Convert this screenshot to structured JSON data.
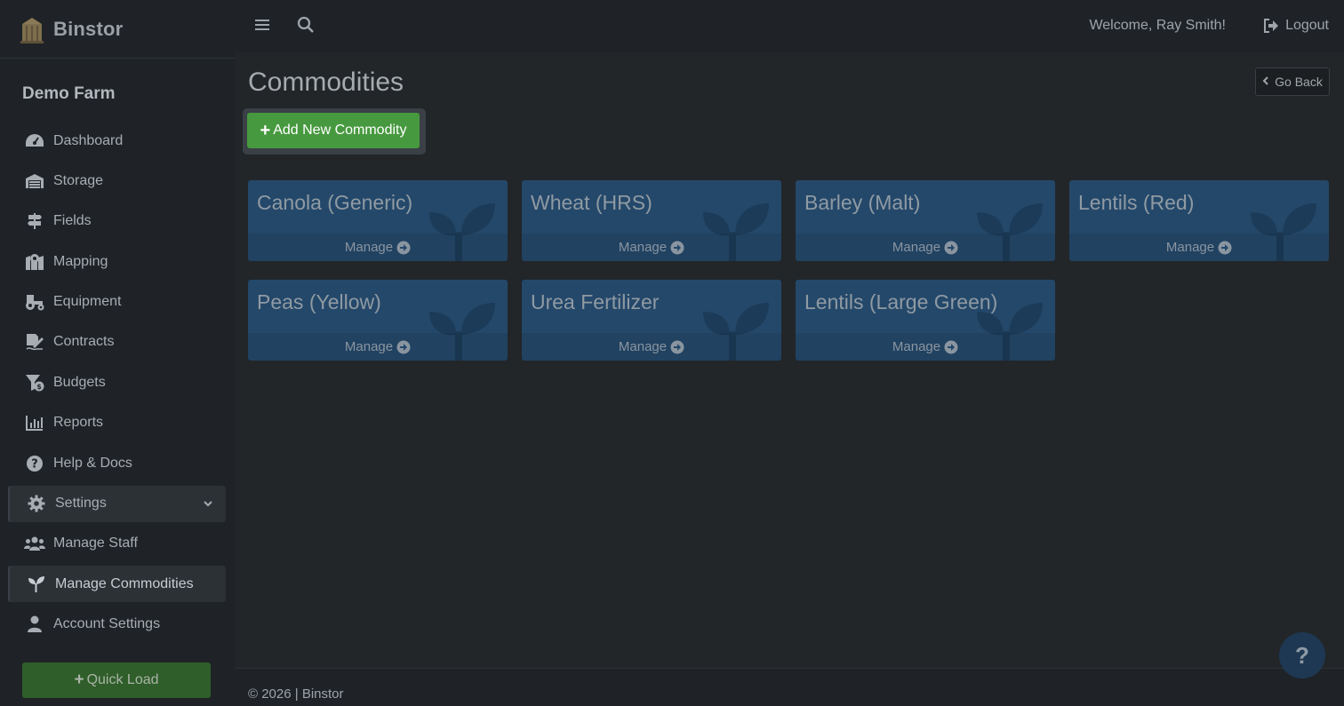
{
  "brand": {
    "name": "Binstor"
  },
  "sidebar": {
    "farm_name": "Demo Farm",
    "items": [
      {
        "label": "Dashboard",
        "icon": "gauge-icon"
      },
      {
        "label": "Storage",
        "icon": "warehouse-icon"
      },
      {
        "label": "Fields",
        "icon": "signs-icon"
      },
      {
        "label": "Mapping",
        "icon": "map-marker-icon"
      },
      {
        "label": "Equipment",
        "icon": "tractor-icon"
      },
      {
        "label": "Contracts",
        "icon": "signature-icon"
      },
      {
        "label": "Budgets",
        "icon": "funnel-dollar-icon"
      },
      {
        "label": "Reports",
        "icon": "bar-chart-icon"
      },
      {
        "label": "Help & Docs",
        "icon": "question-circle-icon"
      },
      {
        "label": "Settings",
        "icon": "gear-icon",
        "state": "open"
      },
      {
        "label": "Manage Staff",
        "icon": "users-icon"
      },
      {
        "label": "Manage Commodities",
        "icon": "seedling-icon",
        "state": "active"
      },
      {
        "label": "Account Settings",
        "icon": "user-icon"
      }
    ],
    "quick_load": "Quick Load"
  },
  "topbar": {
    "welcome": "Welcome, Ray Smith!",
    "logout": "Logout"
  },
  "main": {
    "title": "Commodities",
    "go_back": "Go Back",
    "add_button": "Add New Commodity",
    "commodities": [
      {
        "name": "Canola (Generic)",
        "action": "Manage"
      },
      {
        "name": "Wheat (HRS)",
        "action": "Manage"
      },
      {
        "name": "Barley (Malt)",
        "action": "Manage"
      },
      {
        "name": "Lentils (Red)",
        "action": "Manage"
      },
      {
        "name": "Peas (Yellow)",
        "action": "Manage"
      },
      {
        "name": "Urea Fertilizer",
        "action": "Manage"
      },
      {
        "name": "Lentils (Large Green)",
        "action": "Manage"
      }
    ]
  },
  "footer": {
    "copyright": "© 2026 | Binstor"
  },
  "help_fab": {
    "label": "?"
  },
  "colors": {
    "accent_green": "#47993f",
    "card_blue": "#24486a",
    "sidebar_bg": "#1f2327",
    "content_bg": "#222629"
  }
}
